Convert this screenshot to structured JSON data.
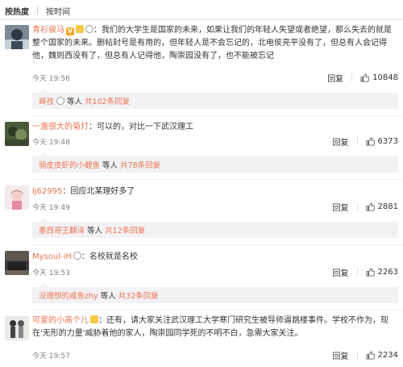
{
  "sort": {
    "hot": "按热度",
    "time": "按时间"
  },
  "comments": [
    {
      "user": "青衫骏马",
      "text": "：我们的大学生是国家的未来，如果让我们的年轻人失望或者绝望，那么失去的就是整个国家的未来。删帖封号是有用的，但年轻人是不会忘记的，北电侯亮平没有了，但总有人会记得他，魏则西没有了，但总有人记得他，陶崇园没有了，也不能被忘记",
      "time": "今天 19:56",
      "reply": "回复",
      "likes": "10848",
      "sub_user": "峄孜",
      "sub_rest": "等人",
      "sub_count": "共102条回复"
    },
    {
      "user": "一盏很大的菊灯",
      "text": "：可以的，对比一下武汉理工",
      "time": "今天 19:48",
      "reply": "回复",
      "likes": "6373",
      "sub_user": "骑皮皮虾的小鲤鱼",
      "sub_rest": "等人",
      "sub_count": "共78条回复"
    },
    {
      "user": "lj62995",
      "text": "：回应北某理好多了",
      "time": "今天 19:49",
      "reply": "回复",
      "likes": "2881",
      "sub_user": "墨西哥王翻泽",
      "sub_rest": "等人",
      "sub_count": "共12条回复"
    },
    {
      "user": "Mysoul-iH",
      "text": "：名校就是名校",
      "time": "今天 19:53",
      "reply": "回复",
      "likes": "2263",
      "sub_user": "没理想的咸鱼zhy",
      "sub_rest": "等人",
      "sub_count": "共32条回复"
    },
    {
      "user": "可爱的小高个儿",
      "text": "：还有，请大家关注武汉理工大学寒门研究生被导师逼跳楼事件。学校不作为，现在'无形的力量'威胁着他的家人，陶崇园同学死的不明不白，急需大家关注。",
      "time": "今天 19:57",
      "reply": "回复",
      "likes": "2234"
    }
  ]
}
